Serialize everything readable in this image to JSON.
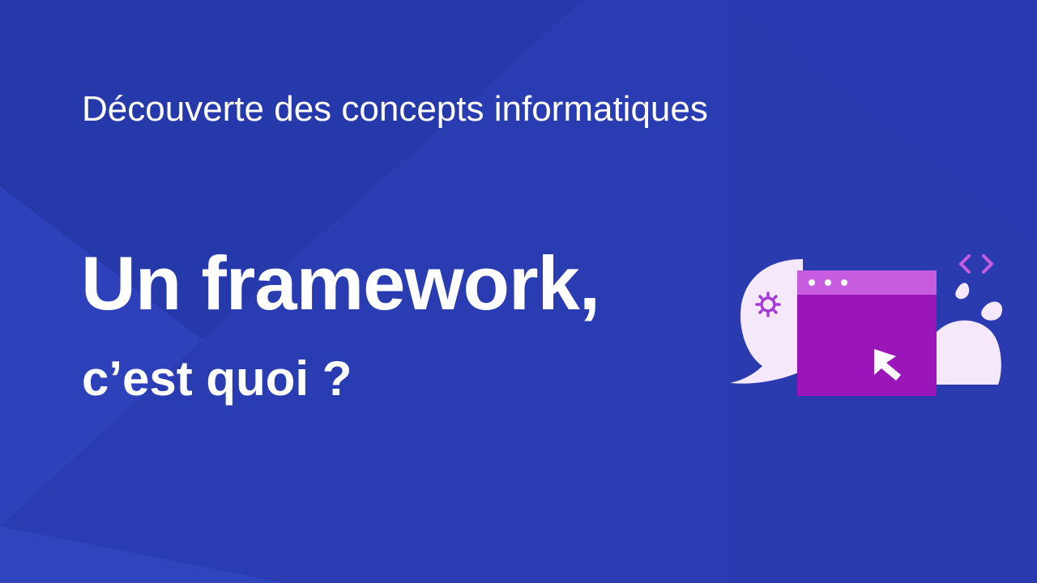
{
  "slide": {
    "subtitle": "Découverte des concepts informatiques",
    "title_line1": "Un framework,",
    "title_line2": "c’est quoi ?"
  },
  "colors": {
    "background": "#2a3bb0",
    "text": "#ffffff",
    "window_body": "#9b16b8",
    "window_titlebar": "#c75ce0",
    "bubble": "#f6e8fb",
    "accent_purple": "#a33ad6"
  },
  "illustration": {
    "icons": [
      "chat-bubble-icon",
      "gear-icon",
      "code-brackets-icon",
      "browser-window-icon",
      "cursor-arrow-icon",
      "drop-icon"
    ]
  }
}
